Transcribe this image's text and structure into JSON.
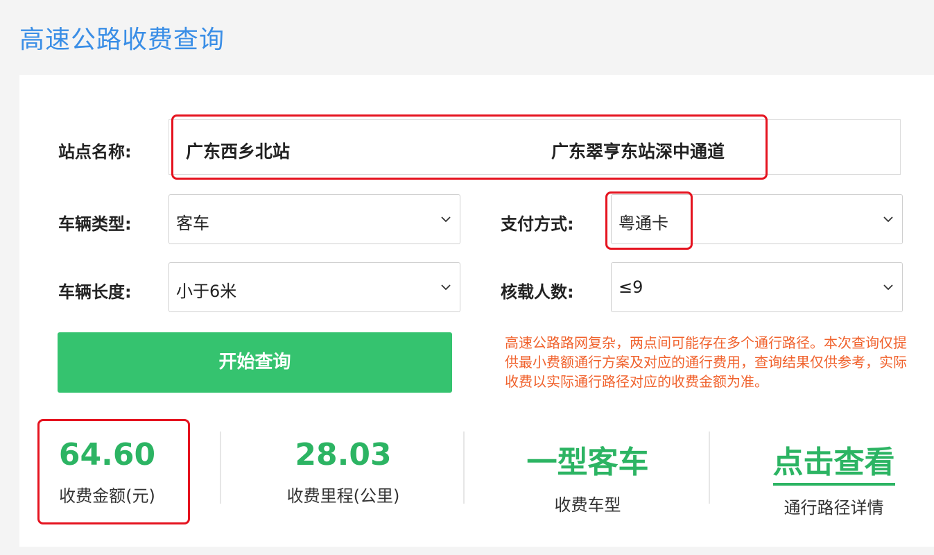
{
  "page": {
    "title": "高速公路收费查询"
  },
  "form": {
    "station_label": "站点名称:",
    "start_station": "广东西乡北站",
    "end_station": "广东翠亨东站深中通道",
    "vehicle_type_label": "车辆类型:",
    "vehicle_type_value": "客车",
    "payment_label": "支付方式:",
    "payment_value": "粤通卡",
    "vehicle_length_label": "车辆长度:",
    "vehicle_length_value": "小于6米",
    "passengers_label": "核载人数:",
    "passengers_value": "≤9"
  },
  "query_button": {
    "label": "开始查询"
  },
  "notice": "高速公路路网复杂，两点间可能存在多个通行路径。本次查询仅提供最小费额通行方案及对应的通行费用，查询结果仅供参考，实际收费以实际通行路径对应的收费金额为准。",
  "results": {
    "fee": {
      "value": "64.60",
      "caption": "收费金额(元)"
    },
    "distance": {
      "value": "28.03",
      "caption": "收费里程(公里)"
    },
    "vehicle_class": {
      "value": "一型客车",
      "caption": "收费车型"
    },
    "route": {
      "value": "点击查看",
      "caption": "通行路径详情"
    }
  },
  "colors": {
    "title": "#3a8ee6",
    "accent_green": "#2cb463",
    "button_green": "#35c36f",
    "notice_orange": "#f0622d",
    "highlight_red": "#e5131f"
  }
}
